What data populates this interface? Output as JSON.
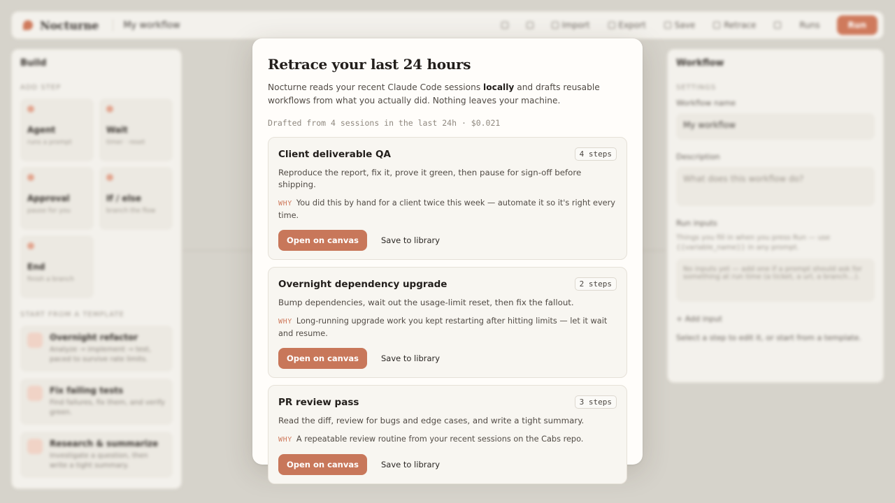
{
  "app": {
    "logo_text": "Nocturne",
    "workflow_name": "My workflow",
    "toolbar": [
      {
        "label": ""
      },
      {
        "label": ""
      },
      {
        "label": "Import"
      },
      {
        "label": "Export"
      },
      {
        "label": "Save"
      },
      {
        "label": "Retrace"
      },
      {
        "label": ""
      },
      {
        "label": "Runs"
      }
    ],
    "run_label": "Run"
  },
  "left_panel": {
    "title": "Build",
    "add_step_label": "ADD STEP",
    "steps": [
      {
        "title": "Agent",
        "sub": "runs a prompt"
      },
      {
        "title": "Wait",
        "sub": "timer · reset"
      },
      {
        "title": "Approval",
        "sub": "pause for you"
      },
      {
        "title": "If / else",
        "sub": "branch the flow"
      },
      {
        "title": "End",
        "sub": "finish a branch"
      }
    ],
    "templates_label": "START FROM A TEMPLATE",
    "templates": [
      {
        "title": "Overnight refactor",
        "sub": "Analyze → implement → test, paced to survive rate limits."
      },
      {
        "title": "Fix failing tests",
        "sub": "Find failures, fix them, and verify green."
      },
      {
        "title": "Research & summarize",
        "sub": "Investigate a question, then write a tight summary."
      }
    ]
  },
  "right_panel": {
    "title": "Workflow",
    "settings_label": "SETTINGS",
    "name_label": "Workflow name",
    "name_value": "My workflow",
    "desc_label": "Description",
    "desc_placeholder": "What does this workflow do?",
    "run_inputs_label": "Run inputs",
    "run_inputs_help": "Things you fill in when you press Run — use {{variable_name}} in any prompt.",
    "run_inputs_empty": "No inputs yet — add one if a prompt should ask for something at run time (a ticket, a url, a branch…).",
    "add_input_label": "+ Add input",
    "hint": "Select a step to edit it, or start from a template."
  },
  "modal": {
    "title": "Retrace your last 24 hours",
    "desc_before": "Nocturne reads your recent Claude Code sessions ",
    "desc_bold": "locally",
    "desc_after": " and drafts reusable workflows from what you actually did. Nothing leaves your machine.",
    "meta": "Drafted from 4 sessions in the last 24h · $0.021",
    "why_tag": "WHY",
    "primary_label": "Open on canvas",
    "secondary_label": "Save to library",
    "cards": [
      {
        "title": "Client deliverable QA",
        "steps": "4 steps",
        "desc": "Reproduce the report, fix it, prove it green, then pause for sign-off before shipping.",
        "why": "You did this by hand for a client twice this week — automate it so it's right every time."
      },
      {
        "title": "Overnight dependency upgrade",
        "steps": "2 steps",
        "desc": "Bump dependencies, wait out the usage-limit reset, then fix the fallout.",
        "why": "Long-running upgrade work you kept restarting after hitting limits — let it wait and resume."
      },
      {
        "title": "PR review pass",
        "steps": "3 steps",
        "desc": "Read the diff, review for bugs and edge cases, and write a tight summary.",
        "why": "A repeatable review routine from your recent sessions on the Cabs repo."
      }
    ]
  },
  "colors": {
    "accent": "#c8775a",
    "background": "#d6d3cb",
    "modal_bg": "#fffdfa"
  }
}
